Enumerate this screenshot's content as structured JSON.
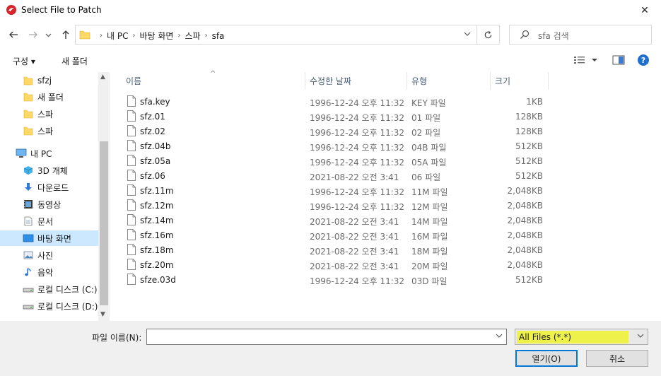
{
  "window": {
    "title": "Select File to Patch",
    "close_label": "✕"
  },
  "address": {
    "crumbs": [
      "내 PC",
      "바탕 화면",
      "스파",
      "sfa"
    ],
    "search_placeholder": "sfa 검색"
  },
  "toolbar": {
    "organize": "구성 ▾",
    "new_folder": "새 폴더"
  },
  "nav": {
    "items": [
      {
        "label": "sfzj",
        "icon": "folder-icon"
      },
      {
        "label": "새 폴더",
        "icon": "folder-icon"
      },
      {
        "label": "스파",
        "icon": "folder-icon"
      },
      {
        "label": "스파",
        "icon": "folder-icon"
      },
      {
        "label": "내 PC",
        "icon": "pc-icon"
      },
      {
        "label": "3D 개체",
        "icon": "cube-icon"
      },
      {
        "label": "다운로드",
        "icon": "download-icon"
      },
      {
        "label": "동영상",
        "icon": "video-icon"
      },
      {
        "label": "문서",
        "icon": "document-icon"
      },
      {
        "label": "바탕 화면",
        "icon": "desktop-icon",
        "selected": true
      },
      {
        "label": "사진",
        "icon": "pictures-icon"
      },
      {
        "label": "음악",
        "icon": "music-icon"
      },
      {
        "label": "로컬 디스크 (C:)",
        "icon": "drive-icon"
      },
      {
        "label": "로컬 디스크 (D:)",
        "icon": "drive-icon"
      }
    ]
  },
  "columns": {
    "name": "이름",
    "modified": "수정한 날짜",
    "type": "유형",
    "size": "크기"
  },
  "files": [
    {
      "name": "sfa.key",
      "modified": "1996-12-24 오후 11:32",
      "type": "KEY 파일",
      "size": "1KB"
    },
    {
      "name": "sfz.01",
      "modified": "1996-12-24 오후 11:32",
      "type": "01 파일",
      "size": "128KB"
    },
    {
      "name": "sfz.02",
      "modified": "1996-12-24 오후 11:32",
      "type": "02 파일",
      "size": "128KB"
    },
    {
      "name": "sfz.04b",
      "modified": "1996-12-24 오후 11:32",
      "type": "04B 파일",
      "size": "512KB"
    },
    {
      "name": "sfz.05a",
      "modified": "1996-12-24 오후 11:32",
      "type": "05A 파일",
      "size": "512KB"
    },
    {
      "name": "sfz.06",
      "modified": "2021-08-22 오전 3:41",
      "type": "06 파일",
      "size": "512KB"
    },
    {
      "name": "sfz.11m",
      "modified": "1996-12-24 오후 11:32",
      "type": "11M 파일",
      "size": "2,048KB"
    },
    {
      "name": "sfz.12m",
      "modified": "1996-12-24 오후 11:32",
      "type": "12M 파일",
      "size": "2,048KB"
    },
    {
      "name": "sfz.14m",
      "modified": "2021-08-22 오전 3:41",
      "type": "14M 파일",
      "size": "2,048KB"
    },
    {
      "name": "sfz.16m",
      "modified": "2021-08-22 오전 3:41",
      "type": "16M 파일",
      "size": "2,048KB"
    },
    {
      "name": "sfz.18m",
      "modified": "2021-08-22 오전 3:41",
      "type": "18M 파일",
      "size": "2,048KB"
    },
    {
      "name": "sfz.20m",
      "modified": "2021-08-22 오전 3:41",
      "type": "20M 파일",
      "size": "2,048KB"
    },
    {
      "name": "sfze.03d",
      "modified": "1996-12-24 오후 11:32",
      "type": "03D 파일",
      "size": "512KB"
    }
  ],
  "bottom": {
    "filename_label": "파일 이름(N):",
    "filename_value": "",
    "filter_value": "All Files (*.*)",
    "open_label": "열기(O)",
    "cancel_label": "취소"
  },
  "colors": {
    "accent": "#0078d7",
    "selection": "#cce8ff",
    "highlight": "#f0f23a",
    "folder": "#ffd867"
  }
}
